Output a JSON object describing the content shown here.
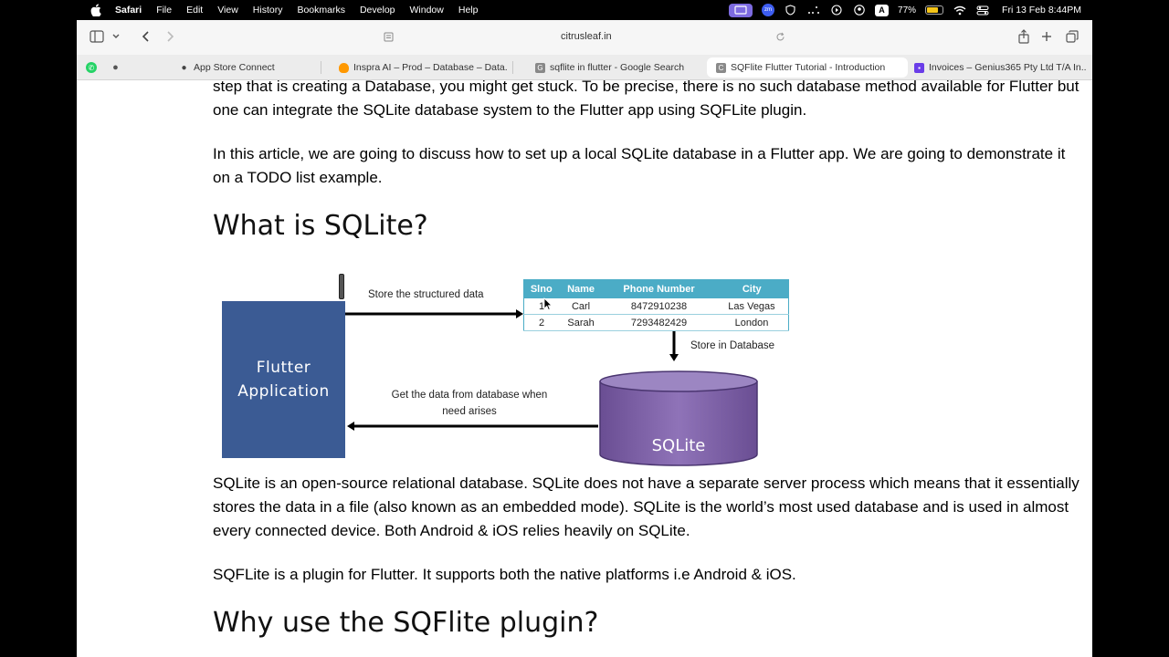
{
  "menubar": {
    "app": "Safari",
    "items": [
      "File",
      "Edit",
      "View",
      "History",
      "Bookmarks",
      "Develop",
      "Window",
      "Help"
    ],
    "battery": "77%",
    "battery_level": 0.77,
    "clock": "Fri 13 Feb  8:44PM"
  },
  "toolbar": {
    "url": "citrusleaf.in"
  },
  "tabs": [
    {
      "label": "App Store Connect",
      "favicon": "apple-icon"
    },
    {
      "label": "Inspra AI – Prod – Database – Data...",
      "favicon": "firebase-icon"
    },
    {
      "label": "sqflite in flutter - Google Search",
      "favicon": "google-icon"
    },
    {
      "label": "SQFlite Flutter Tutorial - Introduction",
      "favicon": "citrusleaf-icon",
      "active": true
    },
    {
      "label": "Invoices – Genius365 Pty Ltd T/A In...",
      "favicon": "invoice-icon"
    }
  ],
  "article": {
    "p1": "step that is creating a Database, you might get stuck. To be precise, there is no such database method available for Flutter but one can integrate the SQLite database system to the Flutter app using SQFLite plugin.",
    "p2": "In this article, we are going to discuss how to set up a local SQLite database in a Flutter app. We are going to demonstrate it on a TODO list example.",
    "h_sqlite": "What is SQLite?",
    "p3": "SQLite is an open-source relational database. SQLite does not have a separate server process which means that it essentially stores the data in a file (also known as an embedded mode). SQLite is the world’s most used database and is used in almost every connected device. Both Android & iOS relies heavily on SQLite.",
    "p4": "SQFLite is a plugin for Flutter. It supports both the native platforms i.e Android & iOS.",
    "h_why": "Why use the SQFlite plugin?"
  },
  "diagram": {
    "flutter_line1": "Flutter",
    "flutter_line2": "Application",
    "store_label": "Store the structured data",
    "get_label_1": "Get the data from database when",
    "get_label_2": "need arises",
    "store_db_label": "Store in Database",
    "sqlite_label": "SQLite",
    "table": {
      "headers": [
        "Slno",
        "Name",
        "Phone Number",
        "City"
      ],
      "rows": [
        [
          "1",
          "Carl",
          "8472910238",
          "Las Vegas"
        ],
        [
          "2",
          "Sarah",
          "7293482429",
          "London"
        ]
      ]
    }
  }
}
